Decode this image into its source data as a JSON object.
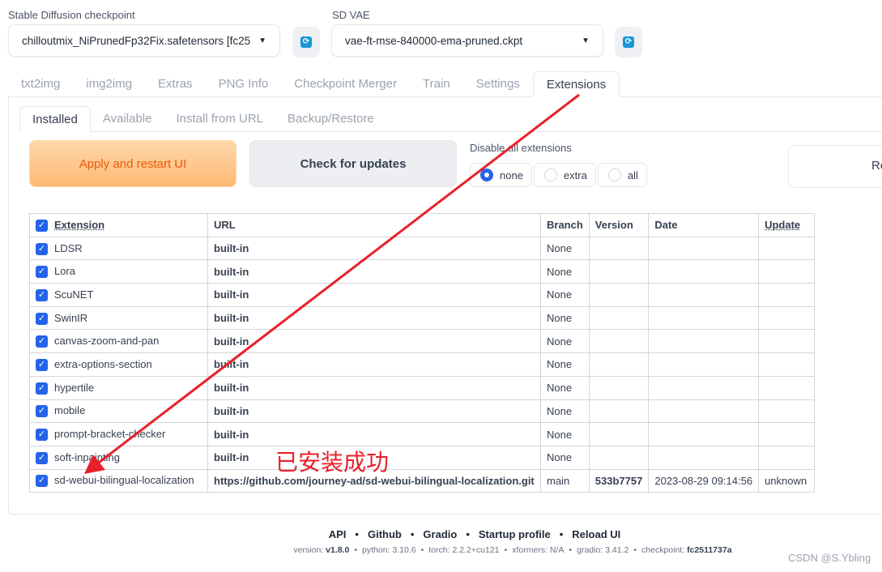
{
  "checkpoint": {
    "label": "Stable Diffusion checkpoint",
    "value": "chilloutmix_NiPrunedFp32Fix.safetensors [fc25"
  },
  "vae": {
    "label": "SD VAE",
    "value": "vae-ft-mse-840000-ema-pruned.ckpt"
  },
  "refresh_icon": "refresh-icon",
  "tabs": [
    "txt2img",
    "img2img",
    "Extras",
    "PNG Info",
    "Checkpoint Merger",
    "Train",
    "Settings",
    "Extensions"
  ],
  "subtabs": [
    "Installed",
    "Available",
    "Install from URL",
    "Backup/Restore"
  ],
  "buttons": {
    "apply": "Apply and restart UI",
    "check": "Check for updates",
    "right_cut": "Re"
  },
  "disable": {
    "label": "Disable all extensions",
    "options": [
      "none",
      "extra",
      "all"
    ],
    "selected": "none"
  },
  "table": {
    "headers": [
      "Extension",
      "URL",
      "Branch",
      "Version",
      "Date",
      "Update"
    ],
    "rows": [
      [
        "LDSR",
        "built-in",
        "None",
        "",
        "",
        ""
      ],
      [
        "Lora",
        "built-in",
        "None",
        "",
        "",
        ""
      ],
      [
        "ScuNET",
        "built-in",
        "None",
        "",
        "",
        ""
      ],
      [
        "SwinIR",
        "built-in",
        "None",
        "",
        "",
        ""
      ],
      [
        "canvas-zoom-and-pan",
        "built-in",
        "None",
        "",
        "",
        ""
      ],
      [
        "extra-options-section",
        "built-in",
        "None",
        "",
        "",
        ""
      ],
      [
        "hypertile",
        "built-in",
        "None",
        "",
        "",
        ""
      ],
      [
        "mobile",
        "built-in",
        "None",
        "",
        "",
        ""
      ],
      [
        "prompt-bracket-checker",
        "built-in",
        "None",
        "",
        "",
        ""
      ],
      [
        "soft-inpainting",
        "built-in",
        "None",
        "",
        "",
        ""
      ],
      [
        "sd-webui-bilingual-localization",
        "https://github.com/journey-ad/sd-webui-bilingual-localization.git",
        "main",
        "533b7757",
        "2023-08-29 09:14:56",
        "unknown"
      ]
    ]
  },
  "footer": {
    "links": [
      "API",
      "Github",
      "Gradio",
      "Startup profile",
      "Reload UI"
    ],
    "version": [
      [
        "version: ",
        "v1.8.0"
      ],
      [
        "python: 3.10.6",
        ""
      ],
      [
        "torch: 2.2.2+cu121",
        ""
      ],
      [
        "xformers: N/A",
        ""
      ],
      [
        "gradio: 3.41.2",
        ""
      ],
      [
        "checkpoint: ",
        "fc2511737a"
      ]
    ]
  },
  "annotation": "已安装成功",
  "watermark": "CSDN @S.Ybling",
  "colors": {
    "accent": "#2563eb",
    "apply_text": "#ea580c",
    "annotation": "#e8202a"
  }
}
